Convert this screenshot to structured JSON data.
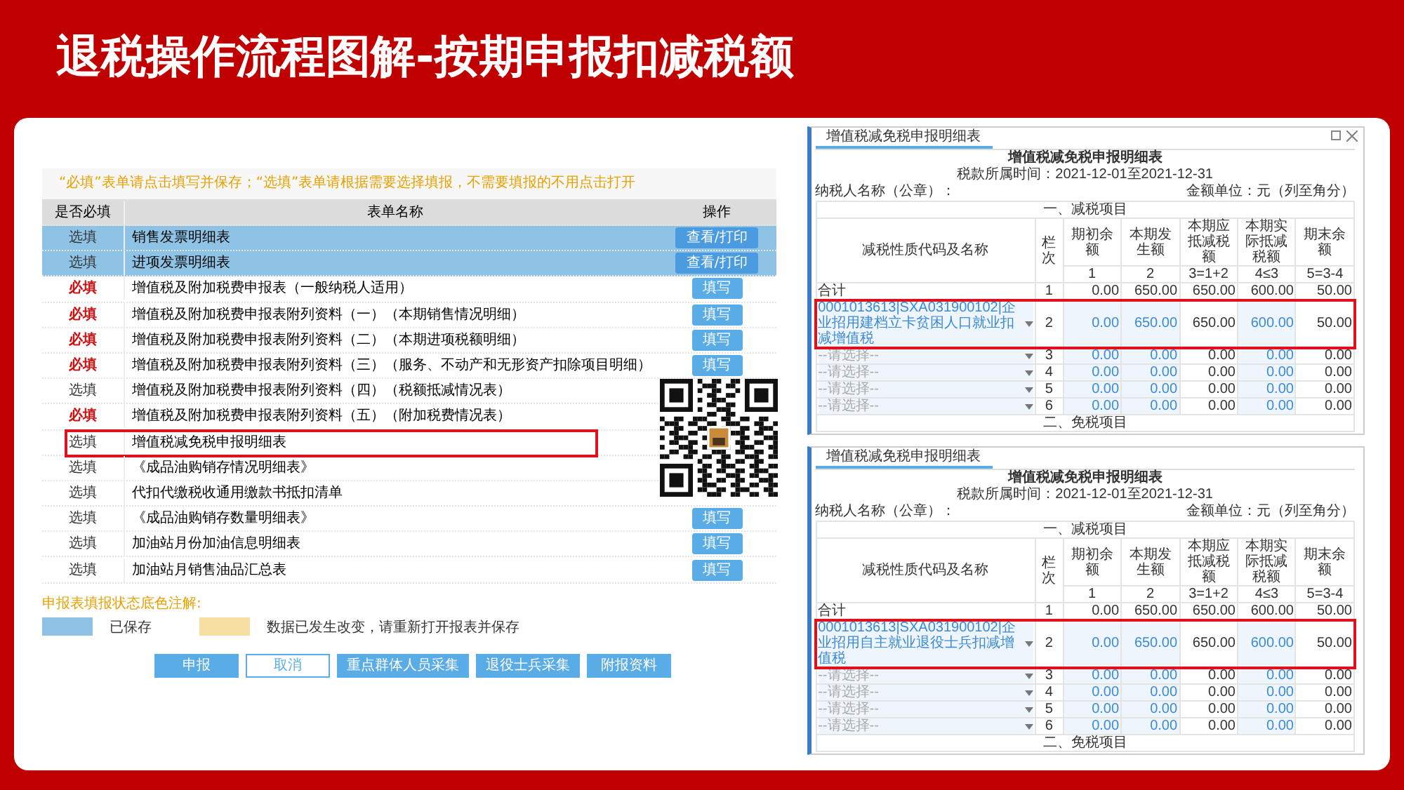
{
  "slide_title": "退税操作流程图解-按期申报扣减税额",
  "declaration_panel": {
    "notice": "“必填”表单请点击填写并保存；“选填”表单请根据需要选择填报，不需要填报的不用点击打开",
    "columns": [
      "是否必填",
      "表单名称",
      "操作"
    ],
    "rows": [
      {
        "requirement": "选填",
        "kind": "optional",
        "form_name": "销售发票明细表",
        "action": "查看/打印",
        "saved": true,
        "highlighted": false
      },
      {
        "requirement": "选填",
        "kind": "optional",
        "form_name": "进项发票明细表",
        "action": "查看/打印",
        "saved": true,
        "highlighted": false
      },
      {
        "requirement": "必填",
        "kind": "required",
        "form_name": "增值税及附加税费申报表（一般纳税人适用）",
        "action": "填写",
        "saved": false,
        "highlighted": false
      },
      {
        "requirement": "必填",
        "kind": "required",
        "form_name": "增值税及附加税费申报表附列资料（一）（本期销售情况明细）",
        "action": "填写",
        "saved": false,
        "highlighted": false
      },
      {
        "requirement": "必填",
        "kind": "required",
        "form_name": "增值税及附加税费申报表附列资料（二）（本期进项税额明细）",
        "action": "填写",
        "saved": false,
        "highlighted": false
      },
      {
        "requirement": "必填",
        "kind": "required",
        "form_name": "增值税及附加税费申报表附列资料（三）（服务、不动产和无形资产扣除项目明细）",
        "action": "填写",
        "saved": false,
        "highlighted": false
      },
      {
        "requirement": "选填",
        "kind": "optional",
        "form_name": "增值税及附加税费申报表附列资料（四）（税额抵减情况表）",
        "saved": false,
        "highlighted": false
      },
      {
        "requirement": "必填",
        "kind": "required",
        "form_name": "增值税及附加税费申报表附列资料（五）（附加税费情况表）",
        "saved": false,
        "highlighted": false
      },
      {
        "requirement": "选填",
        "kind": "optional",
        "form_name": "增值税减免税申报明细表",
        "saved": false,
        "highlighted": true
      },
      {
        "requirement": "选填",
        "kind": "optional",
        "form_name": "《成品油购销存情况明细表》",
        "saved": false,
        "highlighted": false
      },
      {
        "requirement": "选填",
        "kind": "optional",
        "form_name": "代扣代缴税收通用缴款书抵扣清单",
        "saved": false,
        "highlighted": false
      },
      {
        "requirement": "选填",
        "kind": "optional",
        "form_name": "《成品油购销存数量明细表》",
        "action": "填写",
        "saved": false,
        "highlighted": false
      },
      {
        "requirement": "选填",
        "kind": "optional",
        "form_name": "加油站月份加油信息明细表",
        "action": "填写",
        "saved": false,
        "highlighted": false
      },
      {
        "requirement": "选填",
        "kind": "optional",
        "form_name": "加油站月销售油品汇总表",
        "action": "填写",
        "saved": false,
        "highlighted": false
      }
    ],
    "legend_title": "申报表填报状态底色注解:",
    "legend": [
      {
        "color": "#8ec3e6",
        "label": "已保存"
      },
      {
        "color": "#f5dfa3",
        "label": "数据已发生改变，请重新打开报表并保存"
      }
    ],
    "buttons": [
      {
        "label": "申报",
        "kind": "primary"
      },
      {
        "label": "取消",
        "kind": "outline"
      },
      {
        "label": "重点群体人员采集",
        "kind": "primary"
      },
      {
        "label": "退役士兵采集",
        "kind": "primary"
      },
      {
        "label": "附报资料",
        "kind": "primary"
      }
    ]
  },
  "detail_screenshots": [
    {
      "window_controls": true,
      "tab": "增值税减免税申报明细表",
      "title": "增值税减免税申报明细表",
      "period": "税款所属时间：2021-12-01至2021-12-31",
      "taxpayer": "纳税人名称（公章）：",
      "unit": "金额单位：元（列至角分）",
      "section": "一、减税项目",
      "columns": [
        "减税性质代码及名称",
        "栏次",
        "期初余额",
        "本期发生额",
        "本期应抵减税额",
        "本期实际抵减税额",
        "期末余额"
      ],
      "column_numbers": [
        "1",
        "2",
        "3=1+2",
        "4≤3",
        "5=3-4"
      ],
      "rows": [
        {
          "kind": "total",
          "name": "合计",
          "line": "1",
          "values": [
            "0.00",
            "650.00",
            "650.00",
            "600.00",
            "50.00"
          ],
          "highlighted": false
        },
        {
          "kind": "select",
          "name": "0001013613|SXA031900102|企业招用建档立卡贫困人口就业扣减增值税",
          "line": "2",
          "values": [
            "0.00",
            "650.00",
            "650.00",
            "600.00",
            "50.00"
          ],
          "highlighted": true
        },
        {
          "kind": "select",
          "placeholder": "--请选择--",
          "line": "3",
          "values": [
            "0.00",
            "0.00",
            "0.00",
            "0.00",
            "0.00"
          ],
          "highlighted": false
        },
        {
          "kind": "select",
          "placeholder": "--请选择--",
          "line": "4",
          "values": [
            "0.00",
            "0.00",
            "0.00",
            "0.00",
            "0.00"
          ],
          "highlighted": false
        },
        {
          "kind": "select",
          "placeholder": "--请选择--",
          "line": "5",
          "values": [
            "0.00",
            "0.00",
            "0.00",
            "0.00",
            "0.00"
          ],
          "highlighted": false
        },
        {
          "kind": "select",
          "placeholder": "--请选择--",
          "line": "6",
          "values": [
            "0.00",
            "0.00",
            "0.00",
            "0.00",
            "0.00"
          ],
          "highlighted": false
        }
      ],
      "footer_section": "二、免税项目"
    },
    {
      "window_controls": false,
      "tab": "增值税减免税申报明细表",
      "title": "增值税减免税申报明细表",
      "period": "税款所属时间：2021-12-01至2021-12-31",
      "taxpayer": "纳税人名称（公章）：",
      "unit": "金额单位：元（列至角分）",
      "section": "一、减税项目",
      "columns": [
        "减税性质代码及名称",
        "栏次",
        "期初余额",
        "本期发生额",
        "本期应抵减税额",
        "本期实际抵减税额",
        "期末余额"
      ],
      "column_numbers": [
        "1",
        "2",
        "3=1+2",
        "4≤3",
        "5=3-4"
      ],
      "rows": [
        {
          "kind": "total",
          "name": "合计",
          "line": "1",
          "values": [
            "0.00",
            "650.00",
            "650.00",
            "600.00",
            "50.00"
          ],
          "highlighted": false
        },
        {
          "kind": "select",
          "name": "0001013613|SXA031900102|企业招用自主就业退役士兵扣减增值税",
          "line": "2",
          "values": [
            "0.00",
            "650.00",
            "650.00",
            "600.00",
            "50.00"
          ],
          "highlighted": true
        },
        {
          "kind": "select",
          "placeholder": "--请选择--",
          "line": "3",
          "values": [
            "0.00",
            "0.00",
            "0.00",
            "0.00",
            "0.00"
          ],
          "highlighted": false
        },
        {
          "kind": "select",
          "placeholder": "--请选择--",
          "line": "4",
          "values": [
            "0.00",
            "0.00",
            "0.00",
            "0.00",
            "0.00"
          ],
          "highlighted": false
        },
        {
          "kind": "select",
          "placeholder": "--请选择--",
          "line": "5",
          "values": [
            "0.00",
            "0.00",
            "0.00",
            "0.00",
            "0.00"
          ],
          "highlighted": false
        },
        {
          "kind": "select",
          "placeholder": "--请选择--",
          "line": "6",
          "values": [
            "0.00",
            "0.00",
            "0.00",
            "0.00",
            "0.00"
          ],
          "highlighted": false
        }
      ],
      "footer_section": "二、免税项目"
    }
  ]
}
